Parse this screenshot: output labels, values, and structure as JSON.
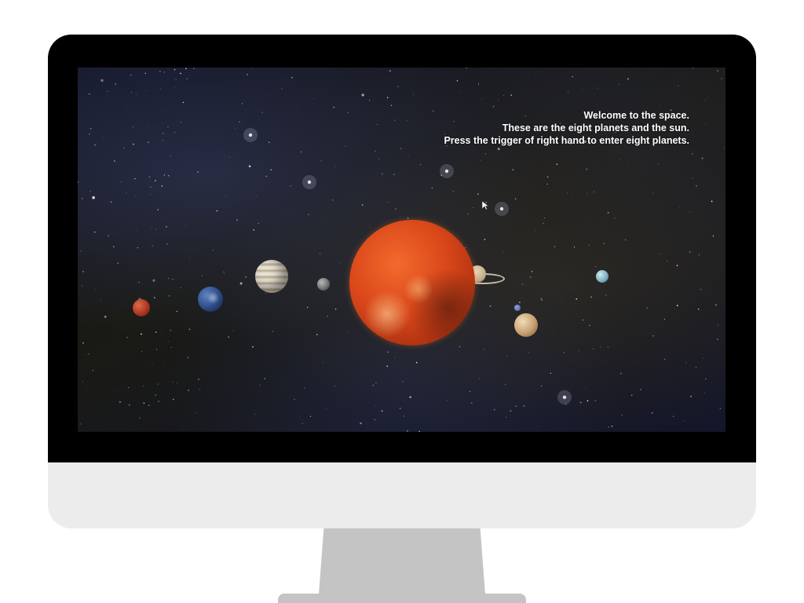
{
  "scene": {
    "welcome_lines": [
      "Welcome to the space.",
      "These are the eight planets and the sun.",
      "Press the trigger of right hand to enter eight planets."
    ]
  },
  "bodies": [
    "sun",
    "mars",
    "earth",
    "jupiter",
    "mercury",
    "saturn",
    "neptune",
    "venus"
  ],
  "colors": {
    "bezel": "#000000",
    "chin": "#ececec",
    "stand": "#c4c4c4",
    "text": "#ffffff",
    "sun": "#d9461a"
  }
}
